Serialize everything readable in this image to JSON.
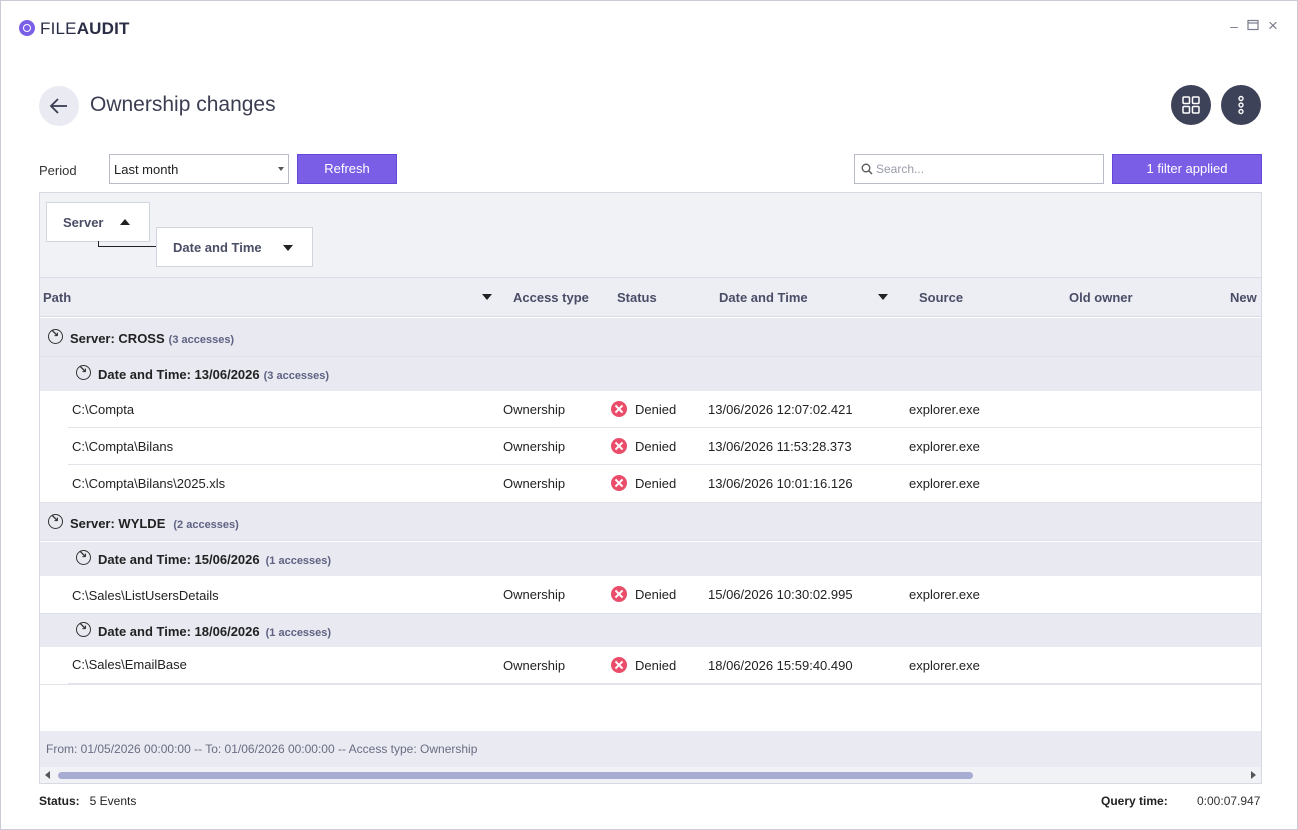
{
  "app": {
    "logo_prefix": "FILE",
    "logo_suffix": "AUDIT"
  },
  "window_controls": {
    "minimize": "–",
    "maximize": "□",
    "close": "×"
  },
  "header": {
    "title": "Ownership changes"
  },
  "toolbar": {
    "period_label": "Period",
    "period_value": "Last month",
    "refresh_label": "Refresh",
    "search_placeholder": "Search...",
    "filter_label": "1 filter applied"
  },
  "group_panel": {
    "chip1": "Server",
    "chip2": "Date and Time"
  },
  "columns": {
    "path": "Path",
    "access_type": "Access type",
    "status": "Status",
    "date_time": "Date and Time",
    "source": "Source",
    "old_owner": "Old owner",
    "new_owner": "New"
  },
  "groups": [
    {
      "label": "Server: CROSS",
      "count": "(3 accesses)",
      "subgroups": [
        {
          "label": "Date and Time: 13/06/2026",
          "count": "(3 accesses)",
          "rows": [
            {
              "path": "C:\\Compta",
              "access_type": "Ownership",
              "status": "Denied",
              "date_time": "13/06/2026 12:07:02.421",
              "source": "explorer.exe"
            },
            {
              "path": "C:\\Compta\\Bilans",
              "access_type": "Ownership",
              "status": "Denied",
              "date_time": "13/06/2026 11:53:28.373",
              "source": "explorer.exe"
            },
            {
              "path": "C:\\Compta\\Bilans\\2025.xls",
              "access_type": "Ownership",
              "status": "Denied",
              "date_time": "13/06/2026 10:01:16.126",
              "source": "explorer.exe"
            }
          ]
        }
      ]
    },
    {
      "label": "Server: WYLDE",
      "count": "(2 accesses)",
      "subgroups": [
        {
          "label": "Date and Time: 15/06/2026",
          "count": "(1 accesses)",
          "rows": [
            {
              "path": "C:\\Sales\\ListUsersDetails",
              "access_type": "Ownership",
              "status": "Denied",
              "date_time": "15/06/2026 10:30:02.995",
              "source": "explorer.exe"
            }
          ]
        },
        {
          "label": "Date and Time: 18/06/2026",
          "count": "(1 accesses)",
          "rows": [
            {
              "path": "C:\\Sales\\EmailBase",
              "access_type": "Ownership",
              "status": "Denied",
              "date_time": "18/06/2026 15:59:40.490",
              "source": "explorer.exe"
            }
          ]
        }
      ]
    }
  ],
  "filter_summary": "From: 01/05/2026 00:00:00 -- To: 01/06/2026 00:00:00 -- Access type: Ownership",
  "status_bar": {
    "status_label": "Status:",
    "status_value": "5 Events",
    "query_label": "Query time:",
    "query_value": "0:00:07.947"
  },
  "colors": {
    "accent": "#7a5fe6",
    "denied": "#ea4d6a",
    "dark_button": "#3d4259"
  }
}
